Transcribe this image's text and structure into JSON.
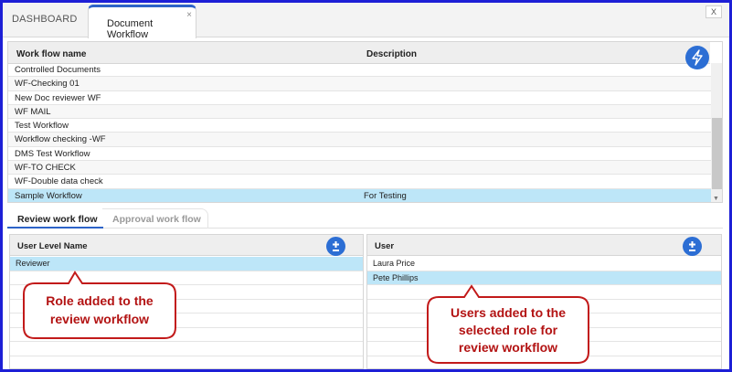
{
  "tabs": {
    "dashboard": "DASHBOARD",
    "document_workflow": "Document Workflow",
    "tab_close": "×",
    "window_close": "X"
  },
  "workflow_table": {
    "columns": [
      "Work flow name",
      "Description"
    ],
    "rows": [
      {
        "name": "Controlled Documents",
        "description": ""
      },
      {
        "name": "WF-Checking 01",
        "description": ""
      },
      {
        "name": "New Doc reviewer WF",
        "description": ""
      },
      {
        "name": "WF MAIL",
        "description": ""
      },
      {
        "name": "Test Workflow",
        "description": ""
      },
      {
        "name": "Workflow checking -WF",
        "description": ""
      },
      {
        "name": "DMS Test Workflow",
        "description": ""
      },
      {
        "name": "WF-TO CHECK",
        "description": ""
      },
      {
        "name": "WF-Double data check",
        "description": ""
      },
      {
        "name": "Sample Workflow",
        "description": "For Testing"
      }
    ],
    "selected_index": 9,
    "action_icon": "lightning-bolt-icon"
  },
  "subtabs": {
    "review": "Review work flow",
    "approval": "Approval work flow",
    "active": "review"
  },
  "roles_panel": {
    "header": "User Level Name",
    "rows": [
      "Reviewer"
    ],
    "selected_index": 0,
    "add_icon": "plus-minus-icon"
  },
  "users_panel": {
    "header": "User",
    "rows": [
      "Laura Price",
      "Pete Phillips"
    ],
    "selected_index": 1,
    "add_icon": "plus-minus-icon"
  },
  "callouts": {
    "role": [
      "Role added to the",
      "review workflow"
    ],
    "users": [
      "Users added to the",
      "selected role for",
      "review workflow"
    ]
  },
  "colors": {
    "frame_border": "#1d1fd6",
    "accent": "#2c6ed4",
    "selected_row": "#bde6f8",
    "callout": "#c21a1a"
  }
}
